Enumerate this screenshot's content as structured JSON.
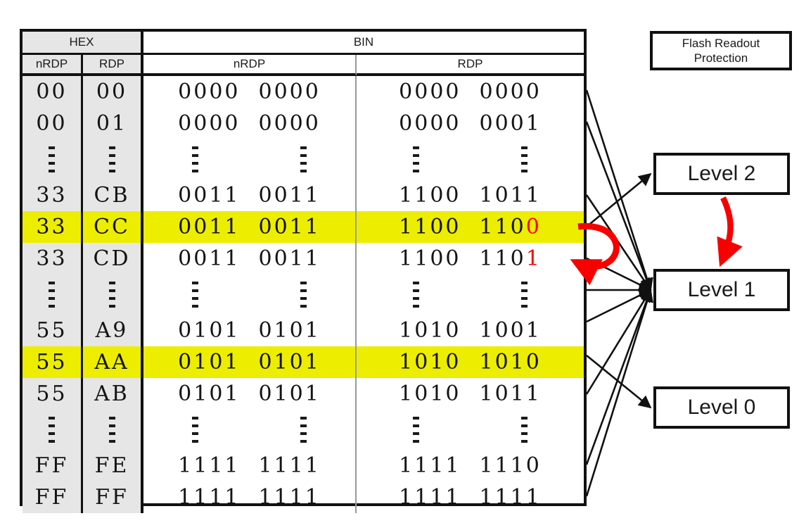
{
  "title": "Flash Readout Protection RDP level mapping",
  "table": {
    "group_headers": [
      {
        "label": "HEX",
        "span": "hex"
      },
      {
        "label": "BIN",
        "span": "bin"
      }
    ],
    "sub_headers": [
      {
        "label": "nRDP",
        "col": "hex-nrdp"
      },
      {
        "label": "RDP",
        "col": "hex-rdp"
      },
      {
        "label": "nRDP",
        "col": "bin-nrdp"
      },
      {
        "label": "RDP",
        "col": "bin-rdp"
      }
    ],
    "rows": [
      {
        "type": "data",
        "highlight": false,
        "hex_nrdp": "00",
        "hex_rdp": "00",
        "bin_nrdp_hi": "0000",
        "bin_nrdp_lo": "0000",
        "bin_rdp_hi": "0000",
        "bin_rdp_lo": "0000",
        "red_last_bit": false
      },
      {
        "type": "data",
        "highlight": false,
        "hex_nrdp": "00",
        "hex_rdp": "01",
        "bin_nrdp_hi": "0000",
        "bin_nrdp_lo": "0000",
        "bin_rdp_hi": "0000",
        "bin_rdp_lo": "0001",
        "red_last_bit": false
      },
      {
        "type": "dots"
      },
      {
        "type": "data",
        "highlight": false,
        "hex_nrdp": "33",
        "hex_rdp": "CB",
        "bin_nrdp_hi": "0011",
        "bin_nrdp_lo": "0011",
        "bin_rdp_hi": "1100",
        "bin_rdp_lo": "1011",
        "red_last_bit": false
      },
      {
        "type": "data",
        "highlight": true,
        "hex_nrdp": "33",
        "hex_rdp": "CC",
        "bin_nrdp_hi": "0011",
        "bin_nrdp_lo": "0011",
        "bin_rdp_hi": "1100",
        "bin_rdp_lo": "110",
        "bin_rdp_red": "0",
        "red_last_bit": true
      },
      {
        "type": "data",
        "highlight": false,
        "hex_nrdp": "33",
        "hex_rdp": "CD",
        "bin_nrdp_hi": "0011",
        "bin_nrdp_lo": "0011",
        "bin_rdp_hi": "1100",
        "bin_rdp_lo": "110",
        "bin_rdp_red": "1",
        "red_last_bit": true
      },
      {
        "type": "dots"
      },
      {
        "type": "data",
        "highlight": false,
        "hex_nrdp": "55",
        "hex_rdp": "A9",
        "bin_nrdp_hi": "0101",
        "bin_nrdp_lo": "0101",
        "bin_rdp_hi": "1010",
        "bin_rdp_lo": "1001",
        "red_last_bit": false
      },
      {
        "type": "data",
        "highlight": true,
        "hex_nrdp": "55",
        "hex_rdp": "AA",
        "bin_nrdp_hi": "0101",
        "bin_nrdp_lo": "0101",
        "bin_rdp_hi": "1010",
        "bin_rdp_lo": "1010",
        "red_last_bit": false
      },
      {
        "type": "data",
        "highlight": false,
        "hex_nrdp": "55",
        "hex_rdp": "AB",
        "bin_nrdp_hi": "0101",
        "bin_nrdp_lo": "0101",
        "bin_rdp_hi": "1010",
        "bin_rdp_lo": "1011",
        "red_last_bit": false
      },
      {
        "type": "dots"
      },
      {
        "type": "data",
        "highlight": false,
        "hex_nrdp": "FF",
        "hex_rdp": "FE",
        "bin_nrdp_hi": "1111",
        "bin_nrdp_lo": "1111",
        "bin_rdp_hi": "1111",
        "bin_rdp_lo": "1110",
        "red_last_bit": false
      },
      {
        "type": "data",
        "highlight": false,
        "hex_nrdp": "FF",
        "hex_rdp": "FF",
        "bin_nrdp_hi": "1111",
        "bin_nrdp_lo": "1111",
        "bin_rdp_hi": "1111",
        "bin_rdp_lo": "1111",
        "red_last_bit": false
      }
    ]
  },
  "boxes": {
    "protection_title_line1": "Flash Readout",
    "protection_title_line2": "Protection",
    "level2": "Level 2",
    "level1": "Level 1",
    "level0": "Level 0"
  },
  "colors": {
    "highlight": "#eded00",
    "red_accent": "#f80000",
    "hex_column_bg": "#e6e6e6",
    "border": "#111111",
    "inner_divider": "#9a9a9a"
  }
}
